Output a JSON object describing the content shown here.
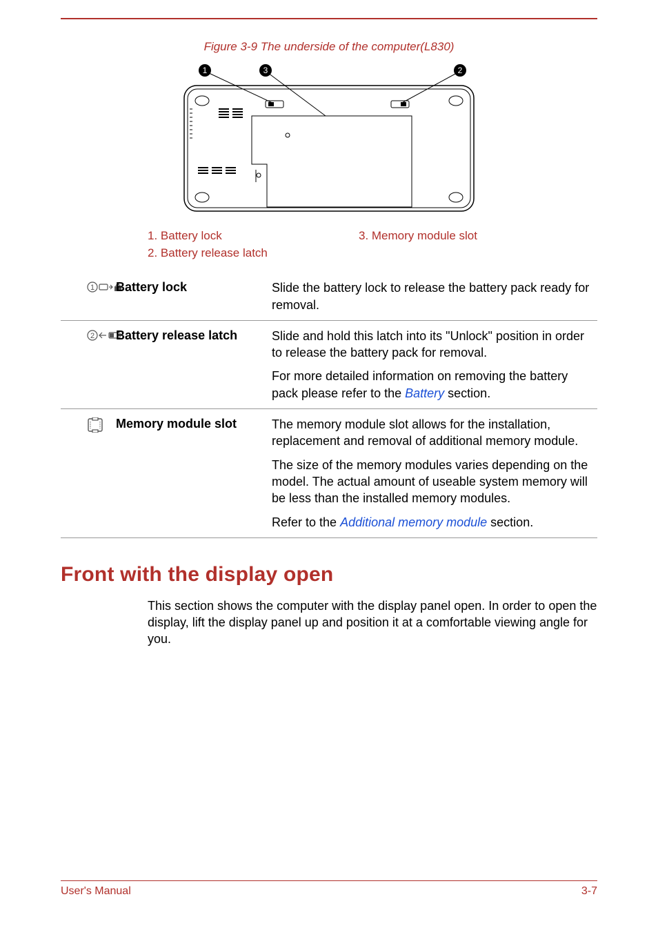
{
  "figure": {
    "caption": "Figure 3-9 The underside of the computer(L830)",
    "callouts": {
      "c1": "1",
      "c2": "2",
      "c3": "3"
    }
  },
  "legend": {
    "col1": {
      "item1": "1. Battery lock",
      "item2": "2. Battery release latch"
    },
    "col2": {
      "item1": "3. Memory module slot"
    }
  },
  "definitions": [
    {
      "term": "Battery lock",
      "paragraphs": [
        {
          "text_before": "Slide the battery lock to release the battery pack ready for removal.",
          "link": "",
          "text_after": ""
        }
      ]
    },
    {
      "term": "Battery release latch",
      "paragraphs": [
        {
          "text_before": "Slide and hold this latch into its \"Unlock\" position in order to release the battery pack for removal.",
          "link": "",
          "text_after": ""
        },
        {
          "text_before": "For more detailed information on removing the battery pack please refer to the ",
          "link": "Battery",
          "text_after": " section."
        }
      ]
    },
    {
      "term": "Memory module slot",
      "paragraphs": [
        {
          "text_before": "The memory module slot allows for the installation, replacement and removal of additional memory module.",
          "link": "",
          "text_after": ""
        },
        {
          "text_before": "The size of the memory modules varies depending on the model. The actual amount of useable system memory will be less than the installed memory modules.",
          "link": "",
          "text_after": ""
        },
        {
          "text_before": "Refer to the ",
          "link": "Additional memory module",
          "text_after": " section."
        }
      ]
    }
  ],
  "section": {
    "heading": "Front with the display open",
    "body": "This section shows the computer with the display panel open. In order to open the display, lift the display panel up and position it at a comfortable viewing angle for you."
  },
  "footer": {
    "left": "User's Manual",
    "right": "3-7"
  }
}
